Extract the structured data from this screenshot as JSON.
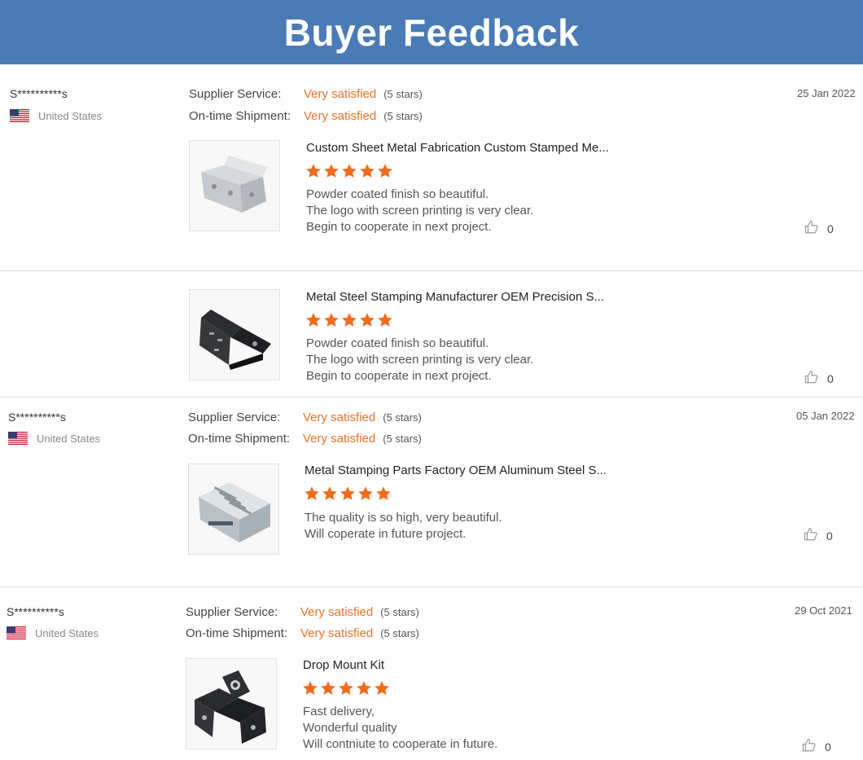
{
  "header": {
    "title": "Buyer Feedback"
  },
  "labels": {
    "supplier_service": "Supplier Service:",
    "on_time_shipment": "On-time Shipment:"
  },
  "reviews": [
    {
      "user": "S**********s",
      "country": "United States",
      "date": "25 Jan 2022",
      "supplier_service": {
        "value": "Very satisfied",
        "stars": "(5 stars)"
      },
      "on_time_shipment": {
        "value": "Very satisfied",
        "stars": "(5 stars)"
      },
      "items": [
        {
          "title": "Custom Sheet Metal Fabrication Custom Stamped Me...",
          "rating": 5,
          "comment": [
            "Powder coated finish so beautiful.",
            "The logo with screen printing is very clear.",
            "Begin to cooperate in next project."
          ],
          "likes": "0"
        },
        {
          "title": "Metal Steel Stamping Manufacturer OEM Precision S...",
          "rating": 5,
          "comment": [
            "Powder coated finish so beautiful.",
            "The logo with screen printing is very clear.",
            "Begin to cooperate in next project."
          ],
          "likes": "0"
        }
      ]
    },
    {
      "user": "S**********s",
      "country": "United States",
      "date": "05 Jan 2022",
      "supplier_service": {
        "value": "Very satisfied",
        "stars": "(5 stars)"
      },
      "on_time_shipment": {
        "value": "Very satisfied",
        "stars": "(5 stars)"
      },
      "items": [
        {
          "title": "Metal Stamping Parts Factory OEM Aluminum Steel S...",
          "rating": 5,
          "comment": [
            "The quality is so high, very beautiful.",
            "Will coperate in future project."
          ],
          "likes": "0"
        }
      ]
    },
    {
      "user": "S**********s",
      "country": "United States",
      "date": "29 Oct 2021",
      "supplier_service": {
        "value": "Very satisfied",
        "stars": "(5 stars)"
      },
      "on_time_shipment": {
        "value": "Very satisfied",
        "stars": "(5 stars)"
      },
      "items": [
        {
          "title": "Drop Mount Kit",
          "rating": 5,
          "comment": [
            "Fast delivery,",
            "Wonderful quality",
            "Will contniute to cooperate in future."
          ],
          "likes": "0"
        }
      ]
    }
  ],
  "colors": {
    "header_bg": "#4a7bb7",
    "accent": "#e8722c",
    "star": "#f26b1d"
  },
  "icons": {
    "flag": "us-flag-icon",
    "like": "thumbs-up-icon",
    "star": "star-icon"
  }
}
